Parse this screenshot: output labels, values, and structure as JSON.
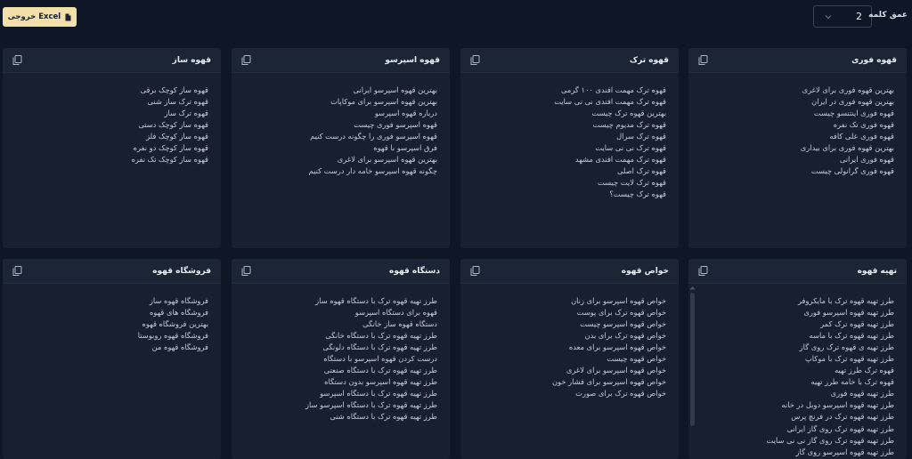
{
  "toolbar": {
    "export_label": "خروجی Excel",
    "depth_label": "عمق کلمه",
    "depth_value": "2"
  },
  "cards": [
    {
      "title": "قهوه فوری",
      "items": [
        "بهترین قهوه فوری برای لاغری",
        "بهترین قهوه فوری در ایران",
        "قهوه فوری اینتنسو چیست",
        "قهوه فوری تک نفره",
        "قهوه فوری علی کافه",
        "بهترین قهوه فوری برای بیداری",
        "قهوه فوری ایرانی",
        "قهوه فوری گرانولی چیست"
      ]
    },
    {
      "title": "قهوه ترک",
      "items": [
        "قهوه ترک مهمت افندی ۱۰۰ گرمی",
        "قهوه ترک مهمت افندی نی نی سایت",
        "بهترین قهوه ترک چیست",
        "قهوه ترک مدیوم چیست",
        "قهوه ترک سرال",
        "قهوه ترک نی نی سایت",
        "قهوه ترک مهمت افندی مشهد",
        "قهوه ترک اصلی",
        "قهوه ترک لایت چیست",
        "قهوه ترک چیست؟"
      ]
    },
    {
      "title": "قهوه اسپرسو",
      "items": [
        "بهترین قهوه اسپرسو ایرانی",
        "بهترین قهوه اسپرسو برای موکاپات",
        "درباره قهوه اسپرسو",
        "قهوه اسپرسو فوری چیست",
        "قهوه اسپرسو فوری را چگونه درست کنیم",
        "فرق اسپرسو با قهوه",
        "بهترین قهوه اسپرسو برای لاغری",
        "چگونه قهوه اسپرسو خامه دار درست کنیم"
      ]
    },
    {
      "title": "قهوه ساز",
      "items": [
        "قهوه ساز کوچک برقی",
        "قهوه ترک ساز شنی",
        "قهوه ترک ساز",
        "قهوه ساز کوچک دستی",
        "قهوه ساز کوچک فلز",
        "قهوه ساز کوچک دو نفره",
        "قهوه ساز کوچک تک نفره"
      ]
    },
    {
      "title": "تهیه قهوه",
      "items": [
        "طرز تهیه قهوه ترک با مایکروفر",
        "طرز تهیه قهوه اسپرسو فوری",
        "طرز تهیه قهوه ترک کمر",
        "طرز تهیه قهوه ترک با ماسه",
        "طرز تهیه ی قهوه ترک روی گاز",
        "طرز تهیه قهوه ترک با موکاپ",
        "قهوه ترک طرز تهیه",
        "قهوه ترک با خامه طرز تهیه",
        "طرز تهیه قهوه فوری",
        "طرز تهیه قهوه اسپرسو دوبل در خانه",
        "طرز تهیه قهوه ترک در فرنچ پرس",
        "طرز تهیه قهوه ترک روی گاز ایرانی",
        "طرز تهیه قهوه ترک روی گاز نی نی سایت",
        "طرز تهیه قهوه اسپرسو روی گاز"
      ]
    },
    {
      "title": "خواص قهوه",
      "items": [
        "خواص قهوه اسپرسو برای زنان",
        "خواص قهوه ترک برای پوست",
        "خواص قهوه اسپرسو چیست",
        "خواص قهوه ترک برای بدن",
        "خواص قهوه اسپرسو برای معده",
        "خواص قهوه چیست",
        "خواص قهوه اسپرسو برای لاغری",
        "خواص قهوه اسپرسو برای فشار خون",
        "خواص قهوه ترک برای صورت"
      ]
    },
    {
      "title": "دستگاه قهوه",
      "items": [
        "طرز تهیه قهوه ترک با دستگاه قهوه ساز",
        "قهوه برای دستگاه اسپرسو",
        "دستگاه قهوه ساز خانگی",
        "طرز تهیه قهوه ترک با دستگاه خانگی",
        "طرز تهیه قهوه ترک با دستگاه دلونگی",
        "درست کردن قهوه اسپرسو با دستگاه",
        "طرز تهیه قهوه ترک با دستگاه صنعتی",
        "طرز تهیه قهوه اسپرسو بدون دستگاه",
        "طرز تهیه قهوه ترک با دستگاه اسپرسو",
        "طرز تهیه قهوه ترک با دستگاه اسپرسو ساز",
        "طرز تهیه قهوه ترک با دستگاه شنی"
      ]
    },
    {
      "title": "فروشگاه قهوه",
      "items": [
        "فروشگاه قهوه ساز",
        "فروشگاه های قهوه",
        "بهترین فروشگاه قهوه",
        "فروشگاه قهوه روبوستا",
        "فروشگاه قهوه من"
      ]
    }
  ]
}
